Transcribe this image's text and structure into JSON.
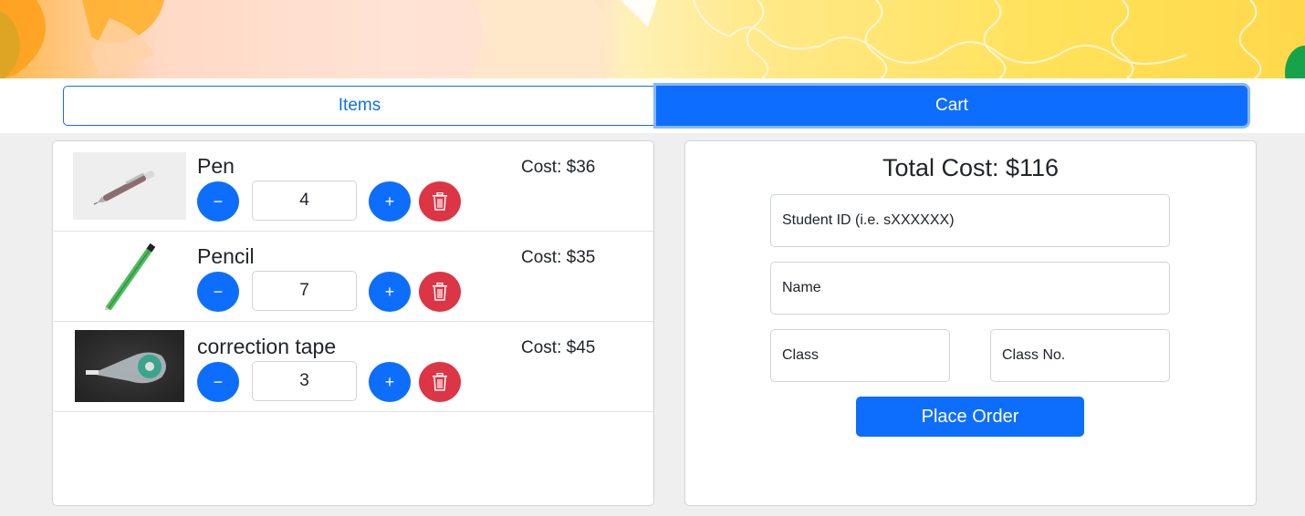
{
  "tabs": {
    "items_label": "Items",
    "cart_label": "Cart",
    "active": "Cart"
  },
  "cart": {
    "items": [
      {
        "name": "Pen",
        "cost": "Cost: $36",
        "quantity": "4"
      },
      {
        "name": "Pencil",
        "cost": "Cost: $35",
        "quantity": "7"
      },
      {
        "name": "correction tape",
        "cost": "Cost: $45",
        "quantity": "3"
      }
    ],
    "minus_symbol": "−",
    "plus_symbol": "+"
  },
  "order": {
    "total": "Total Cost: $116",
    "student_id_placeholder": "Student ID (i.e. sXXXXXX)",
    "name_placeholder": "Name",
    "class_placeholder": "Class",
    "class_no_placeholder": "Class No.",
    "submit_label": "Place Order"
  },
  "colors": {
    "primary": "#0d6efd",
    "danger": "#dc3545",
    "background": "#efefef"
  }
}
